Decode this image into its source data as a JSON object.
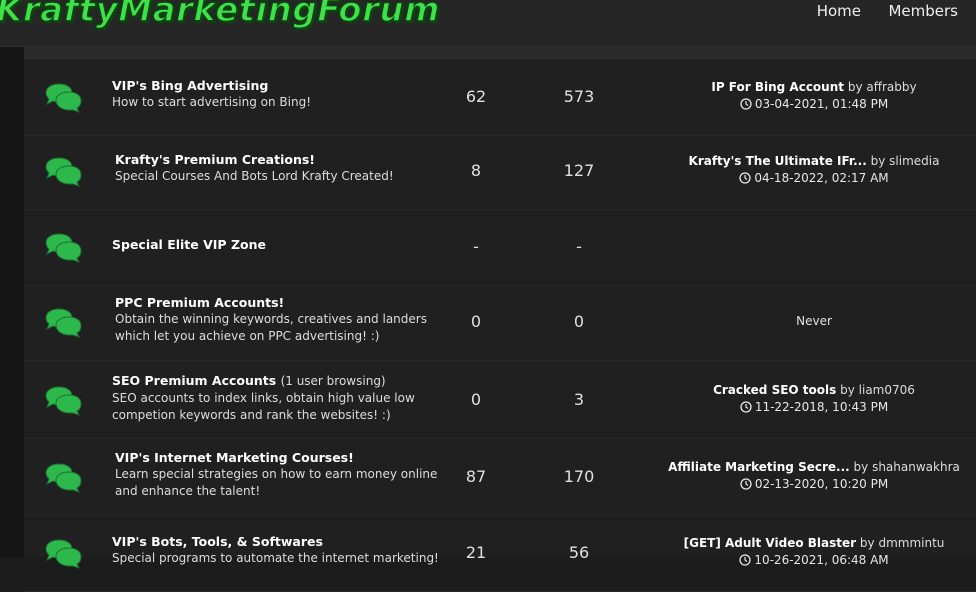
{
  "header": {
    "logo": "KraftyMarketingForum",
    "nav": {
      "home": "Home",
      "members": "Members"
    }
  },
  "colors": {
    "accent": "#3fe04a",
    "icon": "#2db84c"
  },
  "forums": [
    {
      "name": "VIP's Bing Advertising",
      "browsing": "",
      "desc": [
        "How to start advertising on Bing!"
      ],
      "threads": "62",
      "posts": "573",
      "last": {
        "title": "IP For Bing Account",
        "by_label": "by",
        "user": "affrabby",
        "date": "03-04-2021, 01:48 PM"
      },
      "icon": "speech-bubbles-icon"
    },
    {
      "name": "Krafty's Premium Creations!",
      "browsing": "",
      "desc": [
        "Special Courses And Bots Lord Krafty Created!"
      ],
      "threads": "8",
      "posts": "127",
      "last": {
        "title": "Krafty's The Ultimate IFr...",
        "by_label": "by",
        "user": "slimedia",
        "date": "04-18-2022, 02:17 AM"
      },
      "icon": "speech-bubbles-icon"
    },
    {
      "name": "Special Elite VIP Zone",
      "browsing": "",
      "desc": [],
      "threads": "-",
      "posts": "-",
      "last": null,
      "icon": "speech-bubbles-icon"
    },
    {
      "name": "PPC Premium Accounts!",
      "browsing": "",
      "desc": [
        "Obtain the winning keywords, creatives and landers",
        "which let you achieve on PPC advertising! :)"
      ],
      "threads": "0",
      "posts": "0",
      "last_never": "Never",
      "icon": "speech-bubbles-icon"
    },
    {
      "name": "SEO Premium Accounts",
      "browsing": "(1 user browsing)",
      "desc": [
        "SEO accounts to index links, obtain high value low",
        "competion keywords and rank the websites! :)"
      ],
      "threads": "0",
      "posts": "3",
      "last": {
        "title": "Cracked SEO tools",
        "by_label": "by",
        "user": "liam0706",
        "date": "11-22-2018, 10:43 PM"
      },
      "icon": "speech-bubbles-icon"
    },
    {
      "name": "VIP's Internet Marketing Courses!",
      "browsing": "",
      "desc": [
        "Learn special strategies on how to earn money online",
        "and enhance the talent!"
      ],
      "threads": "87",
      "posts": "170",
      "last": {
        "title": "Affiliate Marketing Secre...",
        "by_label": "by",
        "user": "shahanwakhra",
        "date": "02-13-2020, 10:20 PM"
      },
      "icon": "speech-bubbles-icon"
    },
    {
      "name": "VIP's Bots, Tools, & Softwares",
      "browsing": "",
      "desc": [
        "Special programs to automate the internet marketing!"
      ],
      "threads": "21",
      "posts": "56",
      "last": {
        "title": "[GET] Adult Video Blaster",
        "by_label": "by",
        "user": "dmmmintu",
        "date": "10-26-2021, 06:48 AM"
      },
      "icon": "speech-bubbles-icon"
    }
  ]
}
